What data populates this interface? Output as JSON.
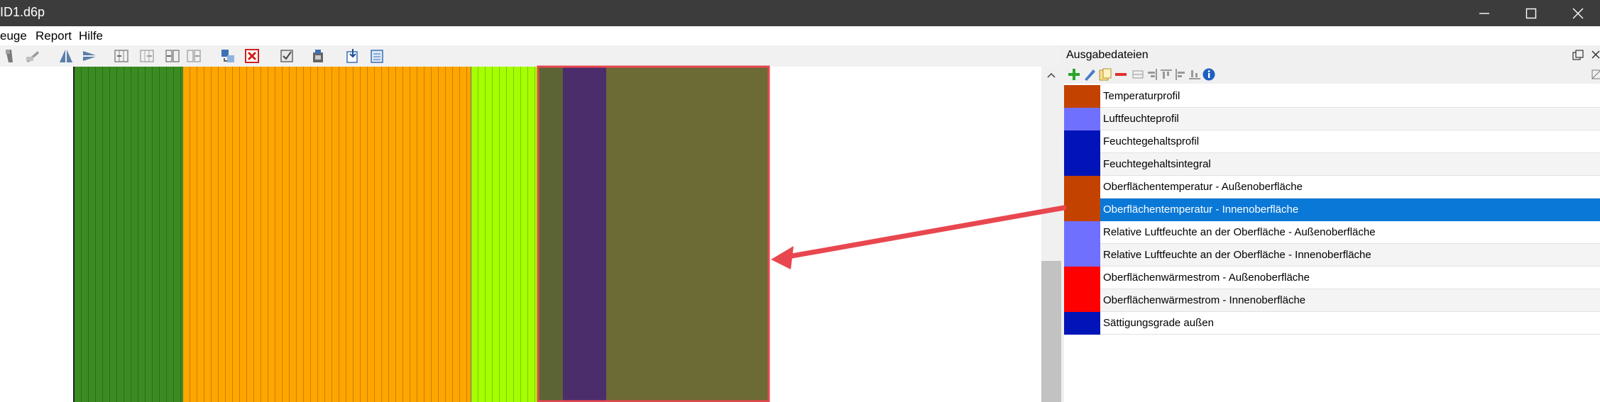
{
  "window": {
    "title": "ID1.d6p"
  },
  "menu": {
    "items": [
      "euge",
      "Report",
      "Hilfe"
    ]
  },
  "toolbar": {
    "icons": [
      "cut-icon",
      "edit-disabled-icon",
      "mirror-icon",
      "align-icon",
      "insert-left-icon",
      "insert-right-icon",
      "split-icon",
      "merge-icon",
      "assign-icon",
      "delete-icon",
      "check-icon",
      "material-icon",
      "import-icon",
      "export-icon"
    ]
  },
  "construction": {
    "layers": [
      {
        "name": "layer-1",
        "color": "#3a8c22"
      },
      {
        "name": "layer-2",
        "color": "#ffa500"
      },
      {
        "name": "layer-3",
        "color": "#a5ff00"
      },
      {
        "name": "layer-4",
        "color": "#5c6435"
      },
      {
        "name": "layer-5",
        "color": "#4c2d6b"
      },
      {
        "name": "layer-6",
        "color": "#6c6a35"
      }
    ],
    "highlight_color": "#e8474f"
  },
  "output_panel": {
    "title": "Ausgabedateien",
    "toolbar_icons": [
      "add-icon",
      "edit-icon",
      "copy-icon",
      "remove-icon",
      "grid-icon",
      "align-right-icon",
      "align-top-icon",
      "align-left-icon",
      "stack-icon",
      "info-icon"
    ],
    "rows": [
      {
        "label": "Temperaturprofil",
        "color": "#c44200",
        "selected": false
      },
      {
        "label": "Luftfeuchteprofil",
        "color": "#7070ff",
        "selected": false
      },
      {
        "label": "Feuchtegehaltsprofil",
        "color": "#0014b8",
        "selected": false
      },
      {
        "label": "Feuchtegehaltsintegral",
        "color": "#0014b8",
        "selected": false
      },
      {
        "label": "Oberflächentemperatur - Außenoberfläche",
        "color": "#c44200",
        "selected": false
      },
      {
        "label": "Oberflächentemperatur - Innenoberfläche",
        "color": "#c44200",
        "selected": true
      },
      {
        "label": "Relative Luftfeuchte an der Oberfläche - Außenoberfläche",
        "color": "#7070ff",
        "selected": false
      },
      {
        "label": "Relative Luftfeuchte an der Oberfläche - Innenoberfläche",
        "color": "#7070ff",
        "selected": false
      },
      {
        "label": "Oberflächenwärmestrom - Außenoberfläche",
        "color": "#ff0000",
        "selected": false
      },
      {
        "label": "Oberflächenwärmestrom - Innenoberfläche",
        "color": "#ff0000",
        "selected": false
      },
      {
        "label": "Sättigungsgrade außen",
        "color": "#0014b8",
        "selected": false
      }
    ]
  },
  "annotation": {
    "arrow_color": "#e8474f"
  }
}
